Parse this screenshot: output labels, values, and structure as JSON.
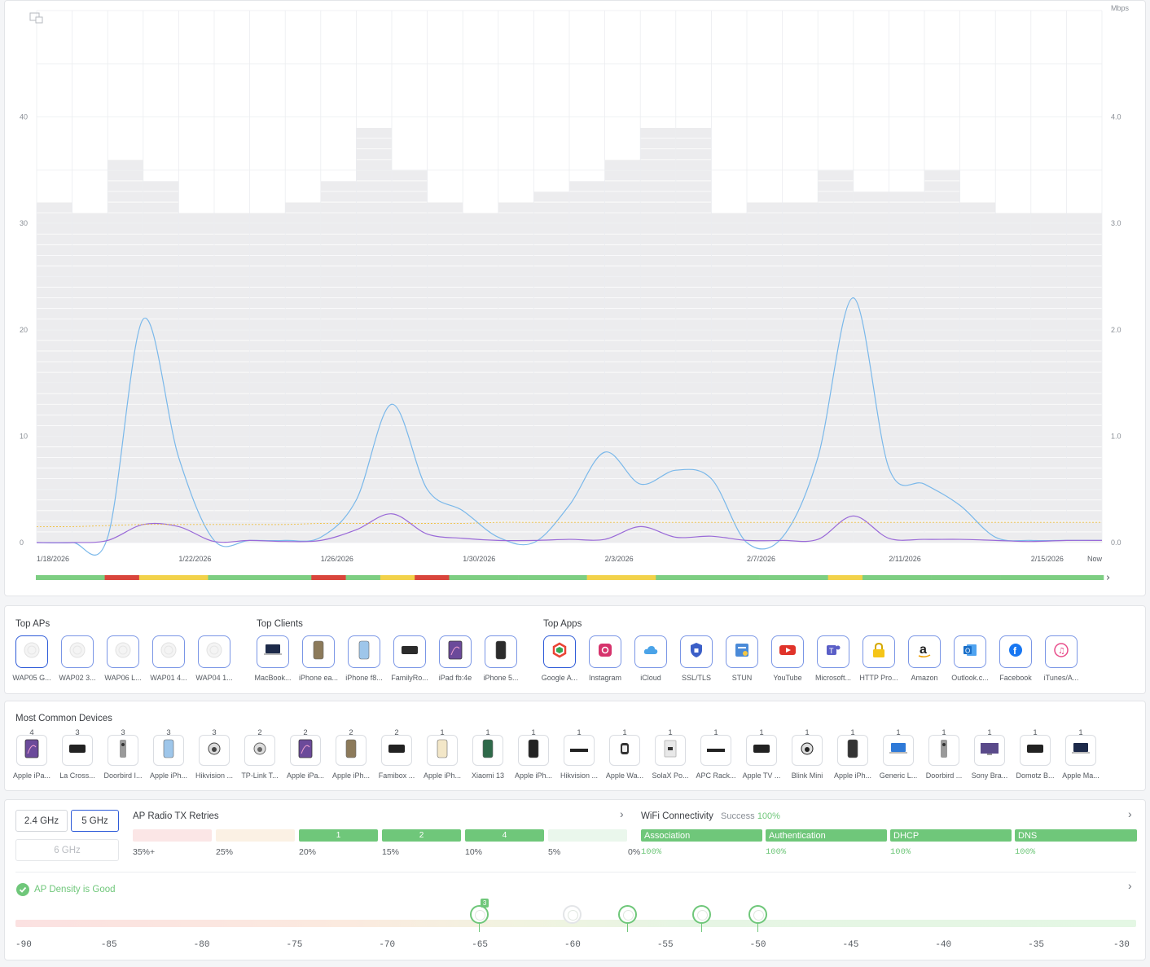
{
  "chart": {
    "y_left_ticks": [
      "40",
      "30",
      "20",
      "10",
      "0"
    ],
    "y_right_unit": "Mbps",
    "y_right_ticks": [
      "4.0",
      "3.0",
      "2.0",
      "1.0",
      "0.0"
    ],
    "x_dates": [
      "1/18/2026",
      "1/22/2026",
      "1/26/2026",
      "1/30/2026",
      "2/3/2026",
      "2/7/2026",
      "2/11/2026",
      "2/15/2026",
      "Now"
    ],
    "colors": {
      "blue_line": "#7ab8ea",
      "purple_line": "#9a6ad8",
      "yellow_line": "#f0c040",
      "bars": "#ececee",
      "good": "#7dce82",
      "warn": "#f2d24a",
      "bad": "#d9453c"
    }
  },
  "chart_data": {
    "type": "line",
    "x": [
      "1/18",
      "1/19",
      "1/20",
      "1/21",
      "1/22",
      "1/23",
      "1/24",
      "1/25",
      "1/26",
      "1/27",
      "1/28",
      "1/29",
      "1/30",
      "1/31",
      "2/1",
      "2/2",
      "2/3",
      "2/4",
      "2/5",
      "2/6",
      "2/7",
      "2/8",
      "2/9",
      "2/10",
      "2/11",
      "2/12",
      "2/13",
      "2/14",
      "2/15",
      "2/16",
      "Now"
    ],
    "client_counts": [
      32,
      31,
      36,
      34,
      31,
      31,
      31,
      32,
      34,
      39,
      35,
      32,
      31,
      32,
      33,
      34,
      36,
      39,
      39,
      31,
      32,
      32,
      35,
      33,
      33,
      35,
      32,
      31,
      31,
      31
    ],
    "series": [
      {
        "axis": "right_mbps",
        "values": [
          0.0,
          0.0,
          0.05,
          2.1,
          0.8,
          0.02,
          0.02,
          0.02,
          0.05,
          0.4,
          1.3,
          0.5,
          0.3,
          0.05,
          0.0,
          0.35,
          0.85,
          0.55,
          0.68,
          0.6,
          0.0,
          0.05,
          0.8,
          2.3,
          0.7,
          0.55,
          0.35,
          0.05,
          0.02,
          0.02,
          0.02
        ]
      },
      {
        "axis": "right_mbps",
        "values": [
          0.0,
          0.0,
          0.02,
          0.17,
          0.15,
          0.01,
          0.02,
          0.01,
          0.02,
          0.12,
          0.27,
          0.08,
          0.04,
          0.02,
          0.02,
          0.03,
          0.03,
          0.15,
          0.05,
          0.06,
          0.02,
          0.02,
          0.03,
          0.25,
          0.04,
          0.03,
          0.03,
          0.02,
          0.01,
          0.02,
          0.02
        ]
      },
      {
        "axis": "left",
        "values": [
          1.5,
          1.5,
          1.6,
          1.7,
          1.7,
          1.7,
          1.7,
          1.7,
          1.8,
          1.8,
          1.8,
          1.8,
          1.8,
          1.9,
          1.9,
          1.9,
          1.9,
          1.9,
          1.9,
          1.9,
          1.9,
          1.9,
          1.9,
          1.9,
          1.9,
          1.9,
          1.9,
          1.9,
          1.9,
          1.9,
          1.9
        ]
      }
    ],
    "left_axis": {
      "ylim": [
        0,
        50
      ]
    },
    "right_axis": {
      "label": "Mbps",
      "ylim": [
        0,
        5
      ]
    },
    "health_strip": [
      "good",
      "good",
      "bad",
      "warn",
      "warn",
      "good",
      "good",
      "good",
      "bad",
      "good",
      "warn",
      "bad",
      "good",
      "good",
      "good",
      "good",
      "warn",
      "warn",
      "good",
      "good",
      "good",
      "good",
      "good",
      "warn",
      "good",
      "good",
      "good",
      "good",
      "good",
      "good",
      "good"
    ]
  },
  "top_aps": {
    "title": "Top APs",
    "items": [
      {
        "label": "WAP05 G...",
        "icon": "access-point-icon"
      },
      {
        "label": "WAP02 3...",
        "icon": "access-point-icon"
      },
      {
        "label": "WAP06 L...",
        "icon": "access-point-icon"
      },
      {
        "label": "WAP01 4...",
        "icon": "access-point-icon"
      },
      {
        "label": "WAP04 1...",
        "icon": "access-point-icon"
      }
    ]
  },
  "top_clients": {
    "title": "Top Clients",
    "items": [
      {
        "label": "MacBook...",
        "icon": "laptop-icon",
        "color": "#1d2a4a"
      },
      {
        "label": "iPhone ea...",
        "icon": "iphone-icon",
        "color": "#8c7a5a"
      },
      {
        "label": "iPhone f8...",
        "icon": "iphone-icon",
        "color": "#9ec6ea"
      },
      {
        "label": "FamilyRo...",
        "icon": "apple-tv-icon",
        "color": "#2b2b2b"
      },
      {
        "label": "iPad fb:4e",
        "icon": "ipad-icon",
        "color": "#6b4a9a"
      },
      {
        "label": "iPhone 5...",
        "icon": "iphone-icon",
        "color": "#2b2b2b"
      }
    ]
  },
  "top_apps": {
    "title": "Top Apps",
    "items": [
      {
        "label": "Google A...",
        "icon": "google-apps-icon",
        "color": "#f4b400"
      },
      {
        "label": "Instagram",
        "icon": "instagram-icon",
        "color": "#d6336c"
      },
      {
        "label": "iCloud",
        "icon": "icloud-icon",
        "color": "#4aa3e8"
      },
      {
        "label": "SSL/TLS",
        "icon": "ssl-shield-icon",
        "color": "#3b5fc8"
      },
      {
        "label": "STUN",
        "icon": "stun-icon",
        "color": "#4a8ad8"
      },
      {
        "label": "YouTube",
        "icon": "youtube-icon",
        "color": "#e0332a"
      },
      {
        "label": "Microsoft...",
        "icon": "teams-icon",
        "color": "#5b5fc7"
      },
      {
        "label": "HTTP Pro...",
        "icon": "lock-icon",
        "color": "#f5c518"
      },
      {
        "label": "Amazon",
        "icon": "amazon-icon",
        "color": "#222222"
      },
      {
        "label": "Outlook.c...",
        "icon": "outlook-icon",
        "color": "#1a6fc8"
      },
      {
        "label": "Facebook",
        "icon": "facebook-icon",
        "color": "#1877f2"
      },
      {
        "label": "iTunes/A...",
        "icon": "itunes-icon",
        "color": "#e84c8a"
      }
    ]
  },
  "common_devices": {
    "title": "Most Common Devices",
    "items": [
      {
        "count": "4",
        "label": "Apple iPa...",
        "icon": "ipad-icon",
        "color": "#6b4a9a"
      },
      {
        "count": "3",
        "label": "La Cross...",
        "icon": "weather-station-icon",
        "color": "#222222"
      },
      {
        "count": "3",
        "label": "Doorbird I...",
        "icon": "doorbell-icon",
        "color": "#9a9a9a"
      },
      {
        "count": "3",
        "label": "Apple iPh...",
        "icon": "iphone-icon",
        "color": "#9ec6ea"
      },
      {
        "count": "3",
        "label": "Hikvision ...",
        "icon": "camera-icon",
        "color": "#444444"
      },
      {
        "count": "2",
        "label": "TP-Link T...",
        "icon": "camera-icon",
        "color": "#666666"
      },
      {
        "count": "2",
        "label": "Apple iPa...",
        "icon": "ipad-icon",
        "color": "#6b4a9a"
      },
      {
        "count": "2",
        "label": "Apple iPh...",
        "icon": "iphone-icon",
        "color": "#8c7a5a"
      },
      {
        "count": "2",
        "label": "Famibox ...",
        "icon": "media-box-icon",
        "color": "#222222"
      },
      {
        "count": "1",
        "label": "Apple iPh...",
        "icon": "iphone-icon",
        "color": "#f3e7c8"
      },
      {
        "count": "1",
        "label": "Xiaomi 13",
        "icon": "phone-icon",
        "color": "#2f6a4a"
      },
      {
        "count": "1",
        "label": "Apple iPh...",
        "icon": "iphone-icon",
        "color": "#222222"
      },
      {
        "count": "1",
        "label": "Hikvision ...",
        "icon": "nvr-icon",
        "color": "#222222"
      },
      {
        "count": "1",
        "label": "Apple Wa...",
        "icon": "watch-icon",
        "color": "#333333"
      },
      {
        "count": "1",
        "label": "SolaX Po...",
        "icon": "inverter-icon",
        "color": "#bbbbbb"
      },
      {
        "count": "1",
        "label": "APC Rack...",
        "icon": "rack-pdu-icon",
        "color": "#222222"
      },
      {
        "count": "1",
        "label": "Apple TV ...",
        "icon": "apple-tv-icon",
        "color": "#222222"
      },
      {
        "count": "1",
        "label": "Blink Mini",
        "icon": "camera-icon",
        "color": "#222222"
      },
      {
        "count": "1",
        "label": "Apple iPh...",
        "icon": "iphone-icon",
        "color": "#333333"
      },
      {
        "count": "1",
        "label": "Generic L...",
        "icon": "laptop-icon",
        "color": "#2f7ad8"
      },
      {
        "count": "1",
        "label": "Doorbird ...",
        "icon": "doorbell-icon",
        "color": "#9a9a9a"
      },
      {
        "count": "1",
        "label": "Sony Bra...",
        "icon": "tv-icon",
        "color": "#5a4a8a"
      },
      {
        "count": "1",
        "label": "Domotz B...",
        "icon": "media-box-icon",
        "color": "#222222"
      },
      {
        "count": "1",
        "label": "Apple Ma...",
        "icon": "laptop-icon",
        "color": "#1d2a4a"
      }
    ]
  },
  "radio": {
    "bands": {
      "b24": "2.4 GHz",
      "b5": "5 GHz",
      "b6": "6 GHz"
    },
    "retries": {
      "title": "AP Radio TX Retries",
      "buckets": [
        {
          "threshold": "35%+",
          "count": "",
          "color": "#fbe6e6"
        },
        {
          "threshold": "25%",
          "count": "",
          "color": "#fbf1e4"
        },
        {
          "threshold": "20%",
          "count": "1",
          "color": "#6fc77a"
        },
        {
          "threshold": "15%",
          "count": "2",
          "color": "#6fc77a"
        },
        {
          "threshold": "10%",
          "count": "4",
          "color": "#6fc77a"
        },
        {
          "threshold": "5%",
          "count": "",
          "color": "#eaf7ec"
        },
        {
          "threshold": "0%",
          "count": "",
          "color": ""
        }
      ]
    },
    "wifi": {
      "title": "WiFi Connectivity",
      "success_label": "Success",
      "success_value": "100%",
      "stages": [
        {
          "label": "Association",
          "pct": "100%"
        },
        {
          "label": "Authentication",
          "pct": "100%"
        },
        {
          "label": "DHCP",
          "pct": "100%"
        },
        {
          "label": "DNS",
          "pct": "100%"
        }
      ]
    },
    "density": {
      "status": "AP Density is Good",
      "ticks": [
        "-90",
        "-85",
        "-80",
        "-75",
        "-70",
        "-65",
        "-60",
        "-55",
        "-50",
        "-45",
        "-40",
        "-35",
        "-30"
      ],
      "aps": [
        {
          "dbm": -65,
          "badge": "3",
          "active": true
        },
        {
          "dbm": -60,
          "badge": "",
          "active": false
        },
        {
          "dbm": -57,
          "badge": "",
          "active": true
        },
        {
          "dbm": -53,
          "badge": "",
          "active": true
        },
        {
          "dbm": -50,
          "badge": "",
          "active": true
        }
      ]
    }
  }
}
